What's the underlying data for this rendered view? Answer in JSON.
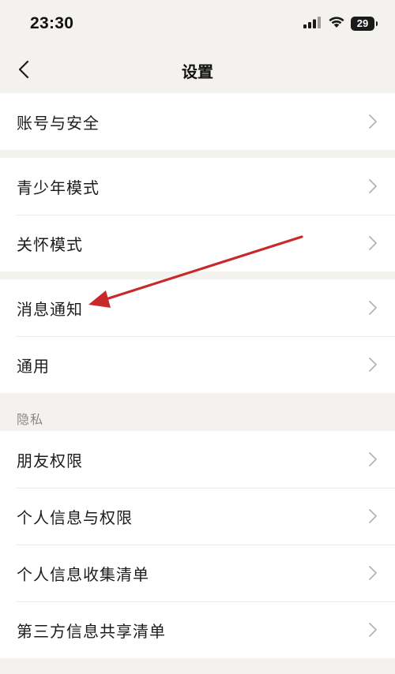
{
  "status_bar": {
    "time": "23:30",
    "battery_level": "29"
  },
  "nav": {
    "title": "设置"
  },
  "groups": [
    {
      "items": [
        {
          "label": "账号与安全"
        }
      ]
    },
    {
      "items": [
        {
          "label": "青少年模式"
        },
        {
          "label": "关怀模式"
        }
      ]
    },
    {
      "items": [
        {
          "label": "消息通知"
        },
        {
          "label": "通用"
        }
      ]
    },
    {
      "section_label": "隐私",
      "items": [
        {
          "label": "朋友权限"
        },
        {
          "label": "个人信息与权限"
        },
        {
          "label": "个人信息收集清单"
        },
        {
          "label": "第三方信息共享清单"
        }
      ]
    }
  ],
  "colors": {
    "background": "#f4f2ee",
    "card": "#ffffff",
    "annotation_arrow": "#c8292b"
  }
}
